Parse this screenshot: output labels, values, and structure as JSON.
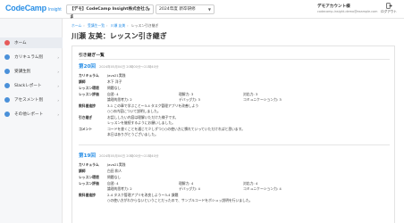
{
  "header": {
    "logo_main": "CodeCamp",
    "logo_sub": "Insight",
    "org": "【デモ】CodeCamp Insight株式会社さま",
    "year": "2024年度 新卒研修",
    "account_name": "デモアカウント様",
    "account_email": "codecamp-insight-demo@example.com",
    "logout_label": "ログアウト"
  },
  "sidebar": {
    "items": [
      {
        "label": "ホーム",
        "icon": "home-icon",
        "color": "#e65a5a",
        "chevron": ""
      },
      {
        "label": "カリキュラム別",
        "icon": "curriculum-icon",
        "color": "#4a90d9",
        "chevron": "›"
      },
      {
        "label": "受講生別",
        "icon": "student-icon",
        "color": "#4a90d9",
        "chevron": "›"
      },
      {
        "label": "Slackレポート",
        "icon": "slack-icon",
        "color": "#4a90d9",
        "chevron": "›"
      },
      {
        "label": "アセスメント別",
        "icon": "assessment-icon",
        "color": "#4a90d9",
        "chevron": "›"
      },
      {
        "label": "その他レポート",
        "icon": "report-icon",
        "color": "#4a90d9",
        "chevron": "›"
      }
    ]
  },
  "breadcrumb": {
    "items": [
      "ホーム",
      "受講生一覧",
      "川瀬 友美",
      "レッスン引き継ぎ"
    ]
  },
  "page": {
    "title": "川瀬 友美：レッスン引き継ぎ",
    "card_title": "引き継ぎ一覧"
  },
  "entries": [
    {
      "num": "第20回",
      "date": "2024年05月04日 20時00分〜21時40分",
      "curriculum_k": "カリキュラム",
      "curriculum_v": "Java21実践",
      "teacher_k": "講師",
      "teacher_v": "木下 洋子",
      "status_k": "レッスン環境",
      "status_v": "問題なし",
      "eval_k": "レッスン評価",
      "eval_a": "自習: 4",
      "eval_b": "理解力: 3",
      "eval_c": "対応力: 3",
      "eval_d": "論理的思考力: 2",
      "eval_e": "デバッグ力: 3",
      "eval_f": "コミュニケーション力: 3",
      "content_k": "教科書進捗",
      "content_v": "3-1 この章で学ぶこと〜3-4 タスク管理アプリを改善しよう",
      "content_v2": "○○の内容について説明しました。",
      "handover_k": "引き継ぎ",
      "handover_v": "お話ししたい内容は理解いただけた様子です。",
      "handover_v2": "レッスンを継続するようにお願いしました。",
      "comment_k": "コメント",
      "comment_v": "コードを書くことを通じて少しずつ○○の使い方に慣れていっていただければと思います。",
      "comment_v2": "本日はありがとうございました。"
    },
    {
      "num": "第19回",
      "date": "2024年05月04日 20時00分〜21時40分",
      "curriculum_k": "カリキュラム",
      "curriculum_v": "Java21実践",
      "teacher_k": "講師",
      "teacher_v": "白田 和人",
      "status_k": "レッスン環境",
      "status_v": "問題なし",
      "eval_k": "レッスン評価",
      "eval_a": "自習: 4",
      "eval_b": "理解力: 4",
      "eval_c": "対応力: 4",
      "eval_d": "論理的思考力: 2",
      "eval_e": "デバッグ力: 4",
      "eval_f": "コミュニケーション力: 4",
      "content_k": "教科書進捗",
      "content_v": "2-4 タスク管理アプリを改良しよう〜3-4 課題",
      "content_v2": "○の使い方がわからないということだったので、サンプルコードをボシュッ説明を行いました。"
    }
  ]
}
